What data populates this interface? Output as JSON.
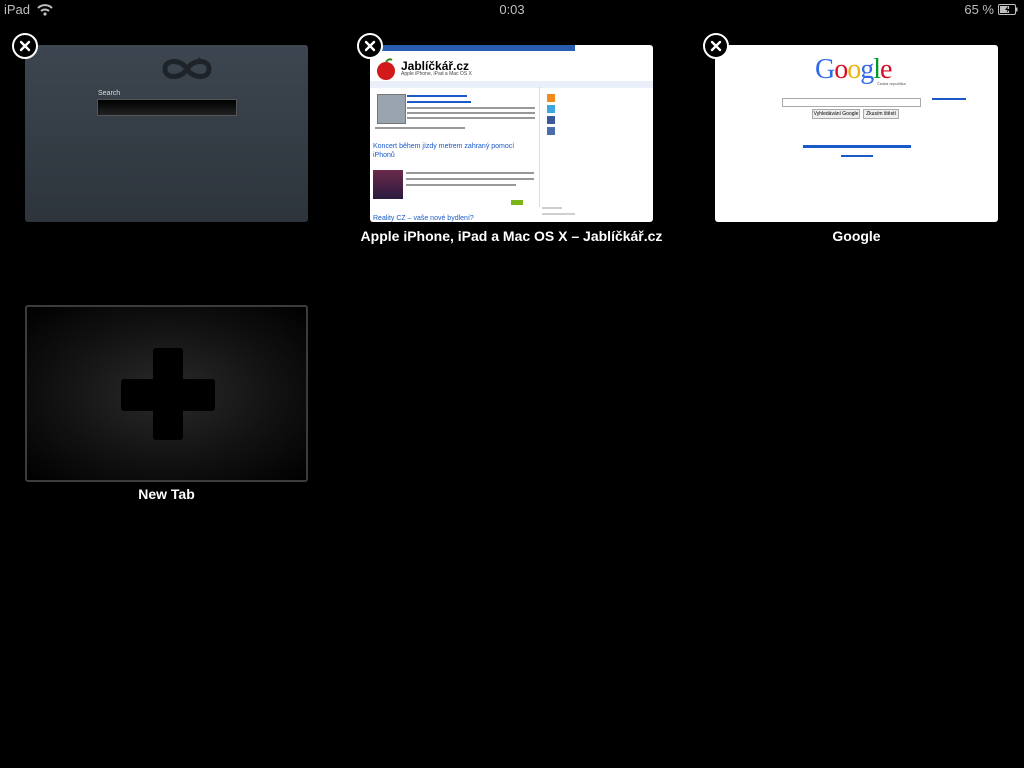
{
  "status_bar": {
    "device": "iPad",
    "time": "0:03",
    "battery": "65 %",
    "battery_level": 0.65
  },
  "tabs": [
    {
      "title": "",
      "thumbnail": {
        "search_label": "Search"
      }
    },
    {
      "title": "Apple iPhone, iPad a Mac OS X – Jablíčkář.cz",
      "thumbnail": {
        "site_name": "Jablíčkář.cz",
        "site_subtitle": "Apple iPhone, iPad a Mac OS X",
        "headline": "Koncert během jízdy metrem zahraný pomocí iPhonů",
        "headline2": "Reality CZ – vaše nové bydlení?"
      }
    },
    {
      "title": "Google",
      "thumbnail": {
        "logo": "Google",
        "logo_sub": "Česká republika",
        "search_button": "Vyhledávání Google",
        "lucky_button": "Zkusím štěstí"
      }
    }
  ],
  "new_tab": {
    "label": "New Tab"
  },
  "colors": {
    "background": "#000000",
    "link_blue": "#1a5ac7",
    "google_blue": "#3369e8",
    "google_red": "#d50f25",
    "google_yellow": "#eeb211",
    "google_green": "#009925"
  },
  "icons": {
    "close": "close-x-icon",
    "wifi": "wifi-icon",
    "battery": "battery-icon",
    "new_tab": "plus-icon"
  }
}
